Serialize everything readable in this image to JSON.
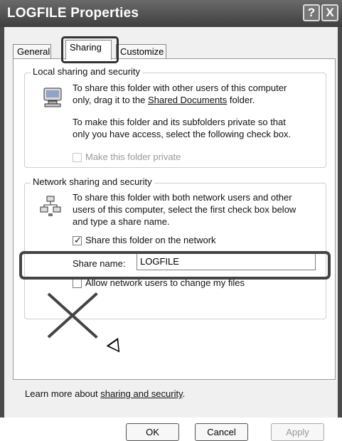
{
  "window": {
    "title": "LOGFILE Properties",
    "help_label": "?",
    "close_label": "X"
  },
  "tabs": [
    "General",
    "Sharing",
    "Customize"
  ],
  "local_group": {
    "title": "Local sharing and security",
    "line1": "To share this folder with other users of this computer",
    "line2_before": "only, drag it to the ",
    "line2_link": "Shared Documents",
    "line2_after": " folder.",
    "para2_line1": "To make this folder and its subfolders private so that",
    "para2_line2": "only you have access, select the following check box.",
    "checkbox_label": "Make this folder private"
  },
  "network_group": {
    "title": "Network sharing and security",
    "line1": "To share this folder with both network users and other",
    "line2": "users of this computer, select the first check box below",
    "line3": "and type a share name.",
    "share_checkbox_label": "Share this folder on the network",
    "share_name_label": "Share name:",
    "share_name_value": "LOGFILE",
    "allow_checkbox_label": "Allow network users to change my files"
  },
  "learn_more": {
    "prefix": "Learn more about ",
    "link": "sharing and security",
    "suffix": "."
  },
  "buttons": {
    "ok": "OK",
    "cancel": "Cancel",
    "apply": "Apply"
  }
}
